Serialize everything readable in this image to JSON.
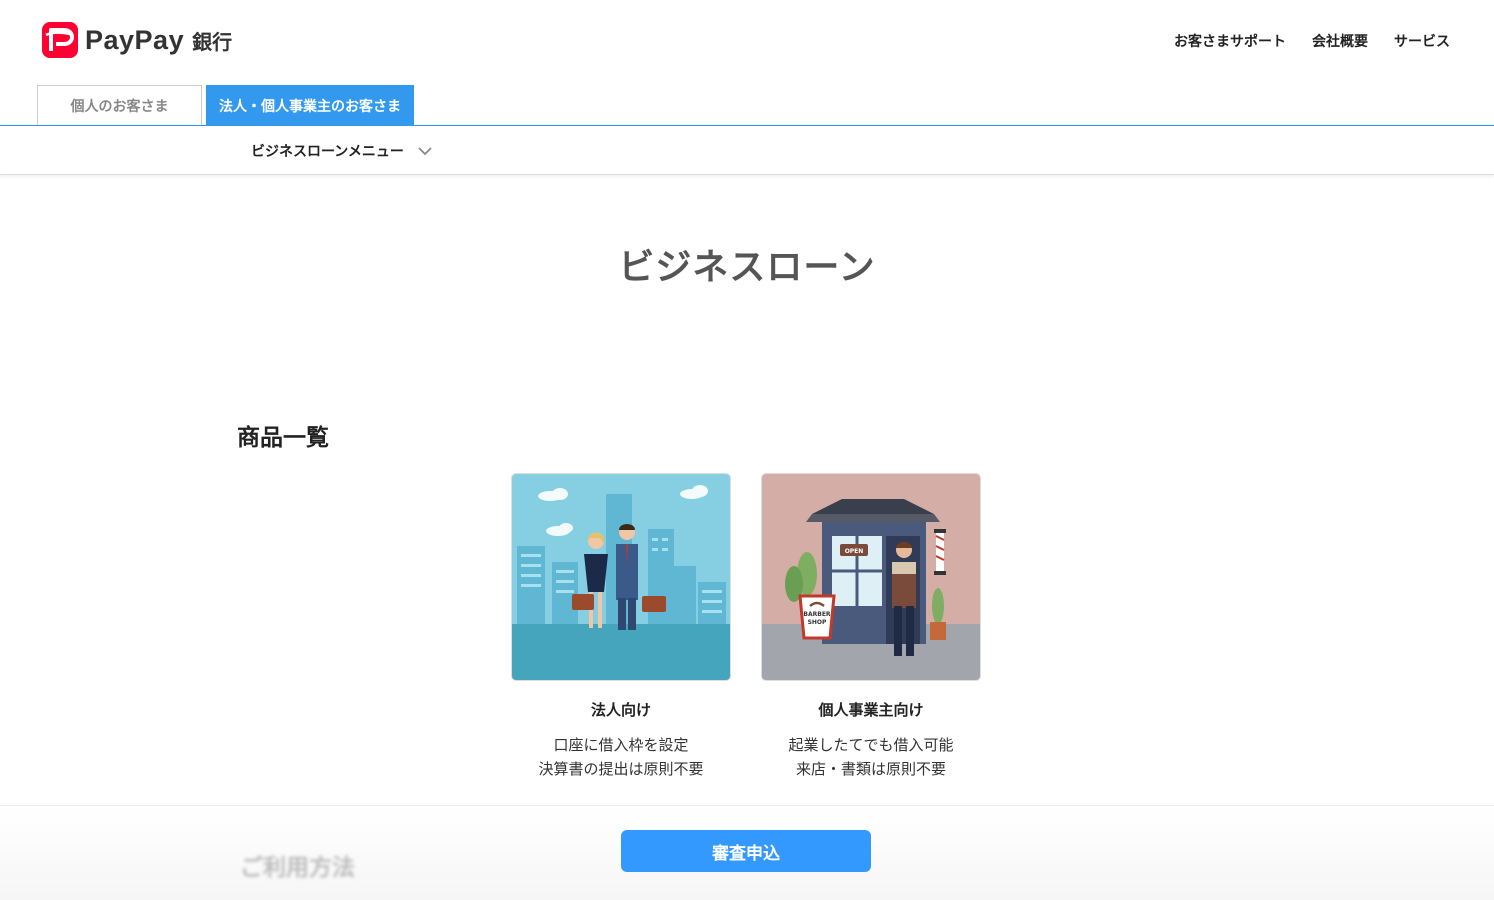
{
  "header": {
    "logo_text": "PayPay",
    "logo_sub": "銀行",
    "nav": [
      "お客さまサポート",
      "会社概要",
      "サービス"
    ]
  },
  "tabs": [
    {
      "label": "個人のお客さま",
      "active": false
    },
    {
      "label": "法人・個人事業主のお客さま",
      "active": true
    }
  ],
  "submenu": {
    "label": "ビジネスローンメニュー",
    "icon": "chevron-down-icon"
  },
  "page_title": "ビジネスローン",
  "products": {
    "heading": "商品一覧",
    "cards": [
      {
        "title": "法人向け",
        "desc": [
          "口座に借入枠を設定",
          "決算書の提出は原則不要"
        ],
        "image": "businesspeople-city-illustration"
      },
      {
        "title": "個人事業主向け",
        "desc": [
          "起業したてでも借入可能",
          "来店・書類は原則不要"
        ],
        "image": "barber-shop-illustration",
        "sign_text": [
          "OPEN",
          "BARBER",
          "SHOP"
        ]
      }
    ]
  },
  "footer": {
    "ghost_heading": "ご利用方法",
    "apply_label": "審査申込"
  },
  "colors": {
    "brand_red": "#ff0033",
    "accent_blue": "#3399ee",
    "button_blue": "#3399ff"
  }
}
